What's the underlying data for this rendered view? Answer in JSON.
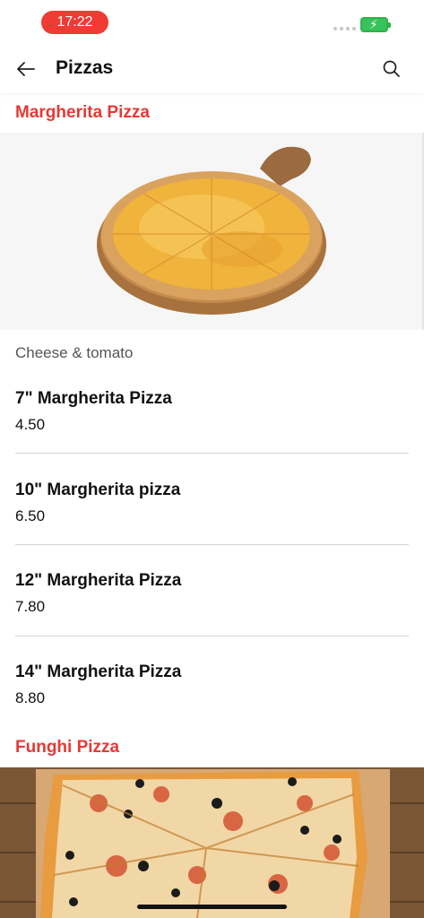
{
  "status": {
    "time": "17:22"
  },
  "header": {
    "title": "Pizzas"
  },
  "sections": [
    {
      "title": "Margherita Pizza",
      "description": "Cheese & tomato",
      "items": [
        {
          "name": "7\" Margherita Pizza",
          "price": "4.50"
        },
        {
          "name": "10\" Margherita pizza",
          "price": "6.50"
        },
        {
          "name": "12\" Margherita Pizza",
          "price": "7.80"
        },
        {
          "name": "14\" Margherita Pizza",
          "price": "8.80"
        }
      ]
    },
    {
      "title": "Funghi Pizza"
    }
  ],
  "icons": {
    "back": "arrow-left-icon",
    "search": "search-icon",
    "battery": "battery-charging-icon"
  },
  "colors": {
    "accent": "#e53935",
    "time_pill": "#ef3b33",
    "battery": "#37c35a"
  }
}
